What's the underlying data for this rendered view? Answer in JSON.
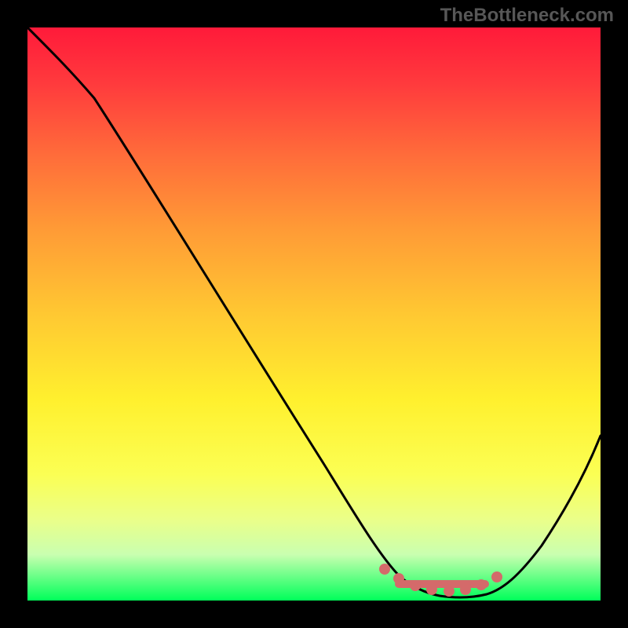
{
  "watermark": "TheBottleneck.com",
  "colors": {
    "page_bg": "#000000",
    "watermark": "#575757",
    "curve": "#000000",
    "markers": "#d46a6a"
  },
  "chart_data": {
    "type": "line",
    "title": "",
    "xlabel": "",
    "ylabel": "",
    "xlim": [
      0,
      100
    ],
    "ylim": [
      0,
      100
    ],
    "grid": false,
    "series": [
      {
        "name": "bottleneck-curve",
        "x": [
          0,
          4,
          10,
          20,
          30,
          40,
          50,
          58,
          62,
          66,
          70,
          74,
          78,
          82,
          86,
          90,
          95,
          100
        ],
        "y": [
          100,
          96,
          90,
          77,
          64,
          51,
          38,
          24,
          15,
          8,
          3,
          1,
          0.5,
          1,
          3,
          8,
          18,
          30
        ]
      }
    ],
    "markers": {
      "name": "highlight-dots",
      "x": [
        62,
        65,
        68,
        71,
        74,
        77,
        80,
        83
      ],
      "y": [
        6,
        4.5,
        3.5,
        2.8,
        2.5,
        2.6,
        3.2,
        4.5
      ]
    }
  }
}
